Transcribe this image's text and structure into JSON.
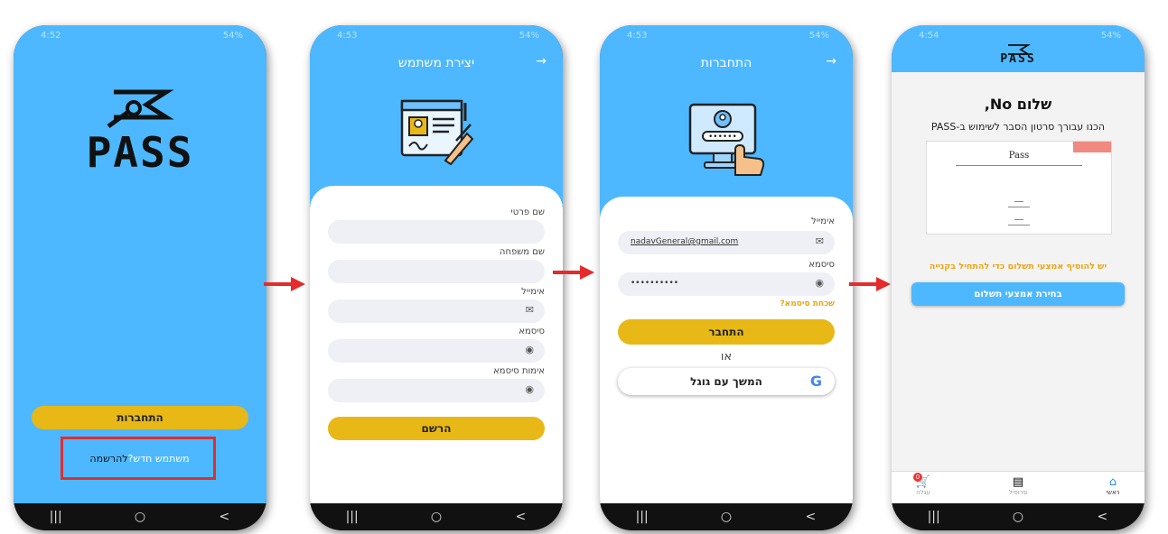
{
  "colors": {
    "primary_blue": "#4db8ff",
    "accent_yellow": "#e8b817",
    "highlight_red": "#e52b2b",
    "warning_orange": "#e8a617"
  },
  "app_logo": "PASS",
  "phone1": {
    "status_left": "4:52",
    "status_right": "54%",
    "login_button": "התחברות",
    "signup_prompt": "משתמש חדש?",
    "signup_link": "להרשמה"
  },
  "phone2": {
    "status_left": "4:53",
    "status_right": "54%",
    "title": "יצירת משתמש",
    "back_icon": "arrow-icon",
    "fields": [
      {
        "label": "שם פרטי",
        "value": ""
      },
      {
        "label": "שם משפחה",
        "value": ""
      },
      {
        "label": "אימייל",
        "icon": "mail-icon",
        "value": ""
      },
      {
        "label": "סיסמא",
        "icon": "eye-icon",
        "value": ""
      },
      {
        "label": "אימות סיסמא",
        "icon": "eye-icon",
        "value": ""
      }
    ],
    "register_button": "הרשם"
  },
  "phone3": {
    "status_left": "4:53",
    "status_right": "54%",
    "title": "התחברות",
    "email_label": "אימייל",
    "email_value": "nadavGeneral@gmail.com",
    "password_label": "סיסמא",
    "password_value": "••••••••••",
    "forgot_password": "שכחת סיסמא?",
    "login_button": "התחבר",
    "or_text": "או",
    "google_button": "המשך עם גוגל"
  },
  "phone4": {
    "status_left": "4:54",
    "status_right": "54%",
    "greeting": "שלום No,",
    "intro": "הכנו עבורך סרטון הסבר לשימוש ב-PASS",
    "video_title": "Pass",
    "notice": "יש להוסיף אמצעי תשלום כדי להתחיל בקנייה",
    "pay_button": "בחירת אמצעי תשלום",
    "tabs": [
      {
        "label": "ראשי",
        "icon": "home-icon"
      },
      {
        "label": "פרופיל",
        "icon": "profile-icon"
      },
      {
        "label": "עגלה",
        "icon": "cart-icon",
        "badge": "0"
      }
    ]
  },
  "nav_buttons": [
    "|||",
    "○",
    "<"
  ]
}
